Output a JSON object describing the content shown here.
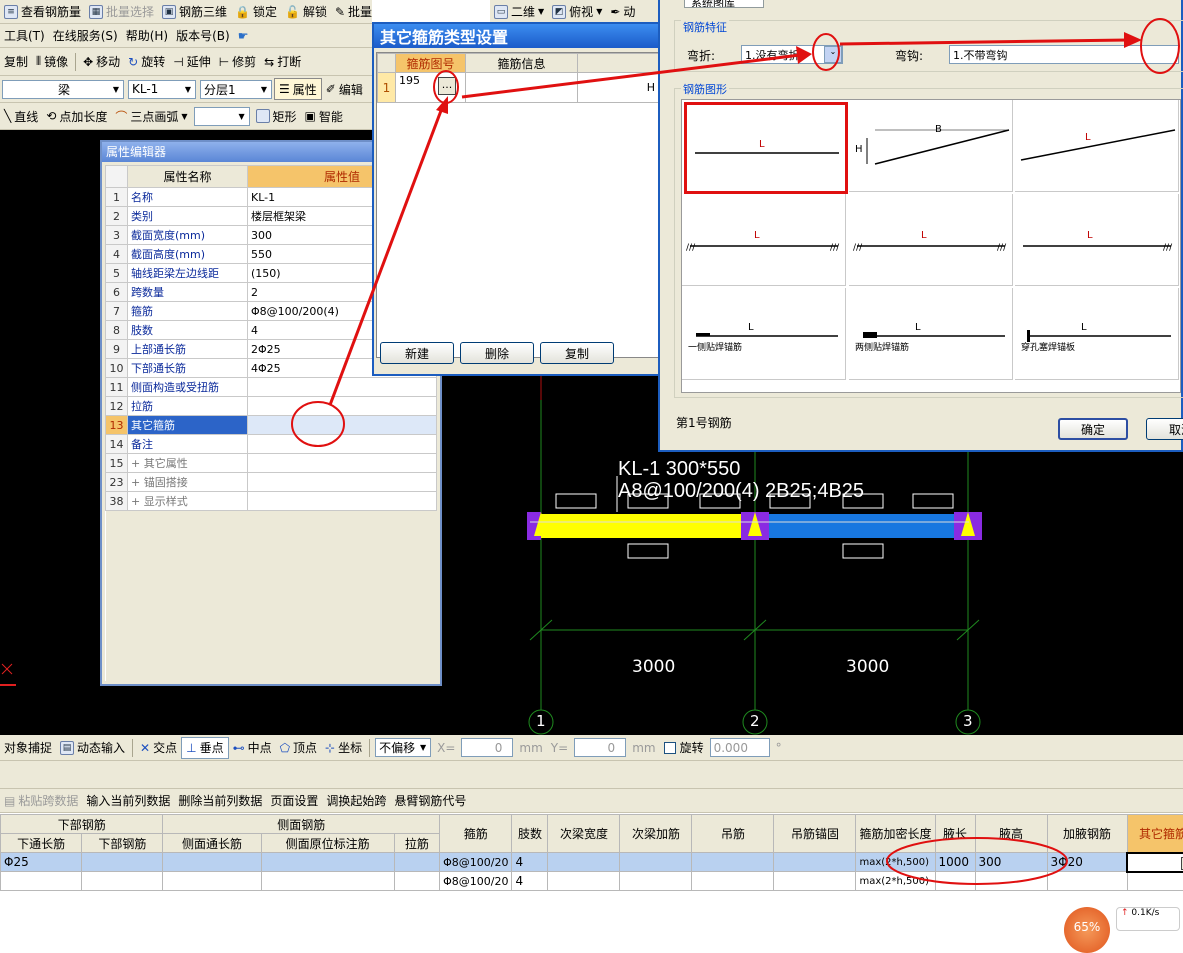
{
  "toolbar1": {
    "view_rebar": "查看钢筋量",
    "batch_select": "批量选择",
    "rebar3d": "钢筋三维",
    "lock": "锁定",
    "unlock": "解锁",
    "batch_delete": "批量删除未使用构件",
    "view2d": "二维",
    "topview": "俯视",
    "dyn": "动"
  },
  "menu": {
    "tools": "工具(T)",
    "online": "在线服务(S)",
    "help": "帮助(H)",
    "version": "版本号(B)"
  },
  "toolbar2": {
    "copy": "复制",
    "mirror": "镜像",
    "move": "移动",
    "rotate": "旋转",
    "extend": "延伸",
    "trim": "修剪",
    "break": "打断"
  },
  "toolbar3": {
    "type": "梁",
    "name": "KL-1",
    "layer": "分层1",
    "prop": "属性",
    "edit": "编辑"
  },
  "toolbar4": {
    "line": "直线",
    "pt_len": "点加长度",
    "arc3": "三点画弧",
    "rect": "矩形",
    "smart": "智能"
  },
  "prop_editor": {
    "title": "属性编辑器",
    "col_name": "属性名称",
    "col_value": "属性值",
    "rows": [
      {
        "n": "1",
        "name": "名称",
        "value": "KL-1"
      },
      {
        "n": "2",
        "name": "类别",
        "value": "楼层框架梁"
      },
      {
        "n": "3",
        "name": "截面宽度(mm)",
        "value": "300"
      },
      {
        "n": "4",
        "name": "截面高度(mm)",
        "value": "550"
      },
      {
        "n": "5",
        "name": "轴线距梁左边线距",
        "value": "(150)"
      },
      {
        "n": "6",
        "name": "跨数量",
        "value": "2"
      },
      {
        "n": "7",
        "name": "箍筋",
        "value": "Φ8@100/200(4)"
      },
      {
        "n": "8",
        "name": "肢数",
        "value": "4"
      },
      {
        "n": "9",
        "name": "上部通长筋",
        "value": "2Φ25"
      },
      {
        "n": "10",
        "name": "下部通长筋",
        "value": "4Φ25"
      },
      {
        "n": "11",
        "name": "侧面构造或受扭筋",
        "value": ""
      },
      {
        "n": "12",
        "name": "拉筋",
        "value": ""
      },
      {
        "n": "13",
        "name": "其它箍筋",
        "value": ""
      },
      {
        "n": "14",
        "name": "备注",
        "value": ""
      },
      {
        "n": "15",
        "name": "+ 其它属性",
        "value": ""
      },
      {
        "n": "23",
        "name": "+ 锚固搭接",
        "value": ""
      },
      {
        "n": "38",
        "name": "+ 显示样式",
        "value": ""
      }
    ]
  },
  "stirrup_dialog": {
    "title": "其它箍筋类型设置",
    "col_shape": "箍筋图号",
    "col_info": "箍筋信息",
    "row_n": "1",
    "row_shape": "195",
    "row_ellipsis": "...",
    "row_h": "H",
    "new_btn": "新建",
    "delete_btn": "删除",
    "copy_btn": "复制"
  },
  "library_dialog": {
    "tab": "系统图库",
    "feature_group": "钢筋特征",
    "bend_label": "弯折:",
    "bend_value": "1.没有弯折",
    "hook_label": "弯钩:",
    "hook_value": "1.不带弯钩",
    "shape_group": "钢筋图形",
    "shape_L": "L",
    "shape_B": "B",
    "shape_H": "H",
    "anchor1": "一侧贴焊锚筋",
    "anchor2": "两侧贴焊锚筋",
    "anchor3": "穿孔塞焊锚板",
    "status": "第1号钢筋",
    "ok_btn": "确定",
    "cancel_btn": "取消"
  },
  "drawing": {
    "beam_label1": "KL-1 300*550",
    "beam_label2": "A8@100/200(4) 2B25;4B25",
    "dim1": "3000",
    "dim2": "3000",
    "axis1": "1",
    "axis2": "2",
    "axis3": "3"
  },
  "snapbar": {
    "obj_snap": "对象捕捉",
    "dyn_input": "动态输入",
    "intersect": "交点",
    "perp": "垂点",
    "mid": "中点",
    "vertex": "顶点",
    "coord": "坐标",
    "offset": "不偏移",
    "x_label": "X=",
    "x_val": "0",
    "y_label": "Y=",
    "y_val": "0",
    "unit": "mm",
    "rotate": "旋转",
    "rot_val": "0.000",
    "deg": "°"
  },
  "table_toolbar": {
    "paste": "粘贴跨数据",
    "input_col": "输入当前列数据",
    "del_col": "删除当前列数据",
    "page_setup": "页面设置",
    "swap_span": "调换起始跨",
    "cantilever": "悬臂钢筋代号"
  },
  "rebar_table": {
    "group_bottom": "下部钢筋",
    "group_side": "侧面钢筋",
    "headers_sub": [
      "下通长筋",
      "下部钢筋",
      "侧面通长筋",
      "侧面原位标注筋",
      "拉筋"
    ],
    "headers": [
      "箍筋",
      "肢数",
      "次梁宽度",
      "次梁加筋",
      "吊筋",
      "吊筋锚固",
      "箍筋加密长度",
      "腋长",
      "腋高",
      "加腋钢筋",
      "其它箍筋"
    ],
    "row1": {
      "bottom": "Φ25",
      "stirrup": "Φ8@100/20",
      "legs": "4",
      "dense": "max(2*h,500)",
      "haunch_len": "1000",
      "haunch_h": "300",
      "haunch_rebar": "3Φ20",
      "other": "..."
    },
    "row2": {
      "stirrup": "Φ8@100/20",
      "legs": "4",
      "dense": "max(2*h,500)"
    }
  },
  "net_widget": {
    "percent": "65%",
    "speed": "0.1K/s"
  }
}
